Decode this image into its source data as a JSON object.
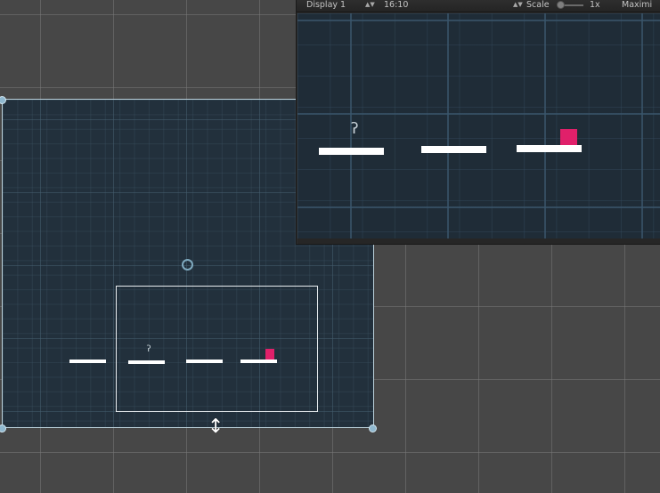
{
  "game_view": {
    "display_label": "Display 1",
    "aspect_label": "16:10",
    "scale_label": "Scale",
    "scale_value": "1x",
    "maximize_label": "Maximi"
  },
  "colors": {
    "scene_background": "#22303c",
    "editor_background": "#474747",
    "platform": "#ffffff",
    "box": "#e0206a",
    "selection_outline": "#bcd2dc"
  },
  "icons": {
    "player": "player-sprite-icon",
    "resize_cursor": "vertical-resize-cursor-icon",
    "pivot": "pivot-circle-icon"
  }
}
